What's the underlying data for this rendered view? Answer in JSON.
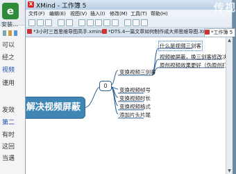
{
  "background_doc": {
    "logo_glyph": "e",
    "file_label": "安装…",
    "lines": [
      "可以",
      "经之",
      "视频",
      "谨用",
      "",
      "发效",
      "第二",
      "有时",
      "这回",
      "当遇"
    ]
  },
  "window": {
    "title": "XMind - 工作簿 5",
    "watermark": "传视",
    "menu": [
      "文件(F)",
      "编辑(E)",
      "视图(V)",
      "插入(I)",
      "修改(M)",
      "工具(T)",
      "帮助(H)"
    ],
    "tabs": [
      {
        "label": "*3小时三首思维导图高手.xmind",
        "active": false
      },
      {
        "label": "*DTS.4一篇文章如何制作成大师思维导图.Xmind",
        "active": false
      },
      {
        "label": "*工作簿 5",
        "active": true
      }
    ]
  },
  "mindmap": {
    "central": "解决视频屏蔽",
    "hub": "0",
    "branch_top": "变换视频三剑客",
    "sub_topics": [
      "什么是视频三剑客",
      "视频被屏蔽，换三剑客修改决",
      "原创视频效果更好（伪原创打折扣）"
    ],
    "branches": [
      "变换视频帧号",
      "变换视频时长",
      "变换视频格式",
      "添加片头片尾"
    ]
  }
}
